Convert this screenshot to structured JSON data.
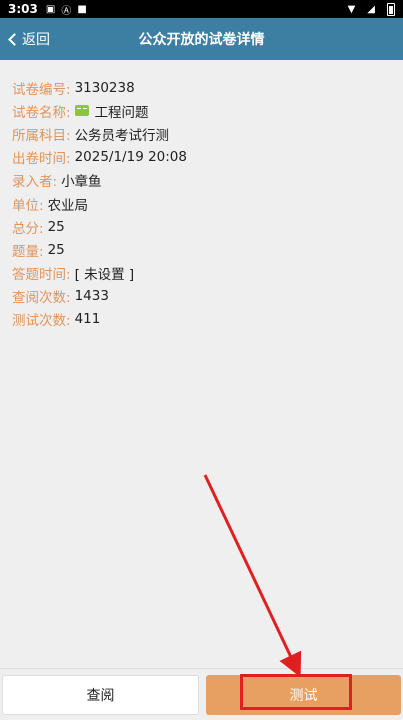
{
  "status_bar": {
    "time": "3:03"
  },
  "header": {
    "back_label": "返回",
    "title": "公众开放的试卷详情"
  },
  "details": [
    {
      "label": "试卷编号:",
      "value": "3130238"
    },
    {
      "label": "试卷名称:",
      "value": "工程问题",
      "icon": "book-icon"
    },
    {
      "label": "所属科目:",
      "value": "公务员考试行测"
    },
    {
      "label": "出卷时间:",
      "value": "2025/1/19 20:08"
    },
    {
      "label": "录入者:",
      "value": "小章鱼"
    },
    {
      "label": "单位:",
      "value": "农业局"
    },
    {
      "label": "总分:",
      "value": "25"
    },
    {
      "label": "题量:",
      "value": "25"
    },
    {
      "label": "答题时间:",
      "value": "[ 未设置 ]"
    },
    {
      "label": "查阅次数:",
      "value": "1433"
    },
    {
      "label": "测试次数:",
      "value": "411"
    }
  ],
  "bottom": {
    "view_label": "查阅",
    "test_label": "测试"
  },
  "colors": {
    "header_bg": "#3c7fa2",
    "label": "#e0945c",
    "test_button": "#e8a062",
    "annotation": "#e02020"
  }
}
